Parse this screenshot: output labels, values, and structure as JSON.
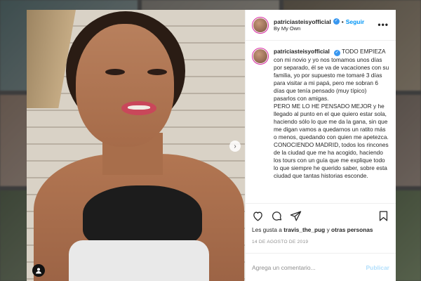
{
  "post": {
    "username": "patriciasteisyofficial",
    "follow_label": "Seguir",
    "separator": "•",
    "location": "By My Own",
    "more_glyph": "•••",
    "caption_lines": [
      "TODO EMPIEZA con mi novio y yo nos tomamos unos días por separado, él se va de vacaciones con su familia, yo por supuesto me tomaré 3 días para visitar a mi papá, pero me sobran 6 días que tenía pensado (muy típico) pasarlos con amigas.",
      "PERO ME LO HE PENSADO MEJOR y he llegado al punto en el que quiero estar sola, haciendo sólo lo que me da la gana, sin que me digan vamos a quedarnos un ratito más o menos, quedando con quien me apetezca.",
      "CONOCIENDO MADRID, todos los rincones de la ciudad que me ha acogido, haciendo los tours con un guía que me explique todo lo que siempre he querido saber, sobre esta ciudad que tantas historias esconde."
    ],
    "likes_prefix": "Les gusta a",
    "likes_user": "travis_the_pug",
    "likes_connector": "y",
    "likes_others": "otras personas",
    "date": "14 DE AGOSTO DE 2019",
    "comment_placeholder": "Agrega un comentario...",
    "publish_label": "Publicar",
    "photo_next_glyph": "›"
  },
  "icons": {
    "verified": "verified-badge-icon",
    "like": "heart-icon",
    "comment": "comment-bubble-icon",
    "share": "paper-plane-icon",
    "save": "bookmark-icon",
    "tagged": "tagged-user-icon",
    "next": "chevron-right-icon"
  },
  "colors": {
    "accent": "#0095f6",
    "verified": "#3897f0",
    "publish_disabled": "#b2dffc",
    "avatar_ring": "#d6249f"
  }
}
